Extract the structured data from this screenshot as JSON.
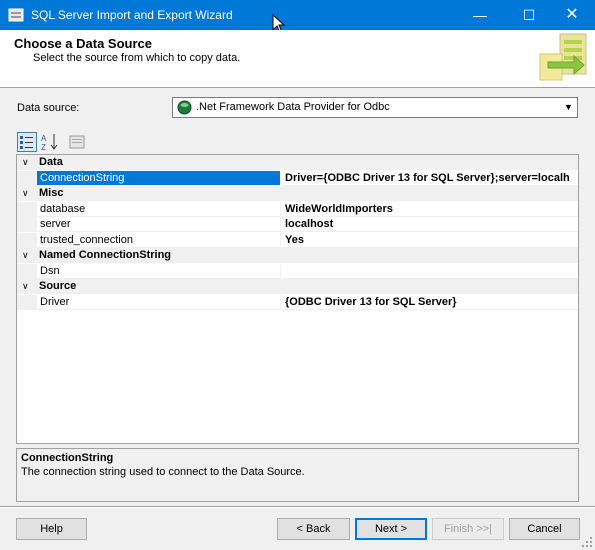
{
  "window": {
    "title": "SQL Server Import and Export Wizard",
    "minimize_glyph": "—",
    "maximize_glyph": "☐",
    "close_glyph": "✕",
    "accent": "#0078d7"
  },
  "header": {
    "title": "Choose a Data Source",
    "subtitle": "Select the source from which to copy data."
  },
  "data_source": {
    "label": "Data source:",
    "selected": ".Net Framework Data Provider for Odbc",
    "arrow": "▼"
  },
  "toolbar": {
    "icons": [
      "categorized-icon",
      "alphabetical-sort-icon",
      "property-pages-icon"
    ]
  },
  "property_grid": {
    "categories": [
      {
        "label": "Data",
        "properties": [
          {
            "name": "ConnectionString",
            "value": "Driver={ODBC Driver 13 for SQL Server};server=localh",
            "selected": true
          }
        ]
      },
      {
        "label": "Misc",
        "properties": [
          {
            "name": "database",
            "value": "WideWorldImporters"
          },
          {
            "name": "server",
            "value": "localhost"
          },
          {
            "name": "trusted_connection",
            "value": "Yes"
          }
        ]
      },
      {
        "label": "Named ConnectionString",
        "properties": [
          {
            "name": "Dsn",
            "value": ""
          }
        ]
      },
      {
        "label": "Source",
        "properties": [
          {
            "name": "Driver",
            "value": "{ODBC Driver 13 for SQL Server}"
          }
        ]
      }
    ],
    "collapse_glyph": "∨"
  },
  "description": {
    "title": "ConnectionString",
    "text": "The connection string used to connect to the Data Source."
  },
  "footer": {
    "help": "Help",
    "back": "< Back",
    "next": "Next >",
    "finish": "Finish >>|",
    "cancel": "Cancel"
  }
}
